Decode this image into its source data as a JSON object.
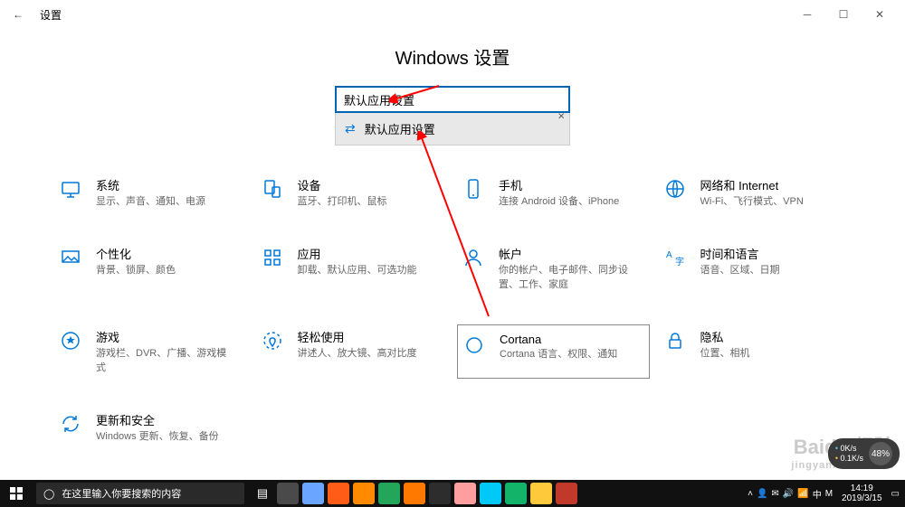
{
  "titlebar": {
    "back": "←",
    "title": "设置"
  },
  "header": {
    "title": "Windows 设置"
  },
  "search": {
    "value": "默认应用设置",
    "clear": "×",
    "suggestion_label": "默认应用设置",
    "suggestion_icon": "⇄"
  },
  "tiles": [
    {
      "key": "system",
      "title": "系统",
      "desc": "显示、声音、通知、电源"
    },
    {
      "key": "devices",
      "title": "设备",
      "desc": "蓝牙、打印机、鼠标"
    },
    {
      "key": "phone",
      "title": "手机",
      "desc": "连接 Android 设备、iPhone"
    },
    {
      "key": "network",
      "title": "网络和 Internet",
      "desc": "Wi-Fi、飞行模式、VPN"
    },
    {
      "key": "personalization",
      "title": "个性化",
      "desc": "背景、锁屏、颜色"
    },
    {
      "key": "apps",
      "title": "应用",
      "desc": "卸载、默认应用、可选功能"
    },
    {
      "key": "accounts",
      "title": "帐户",
      "desc": "你的帐户、电子邮件、同步设置、工作、家庭"
    },
    {
      "key": "time",
      "title": "时间和语言",
      "desc": "语音、区域、日期"
    },
    {
      "key": "gaming",
      "title": "游戏",
      "desc": "游戏栏、DVR、广播、游戏模式"
    },
    {
      "key": "ease",
      "title": "轻松使用",
      "desc": "讲述人、放大镜、高对比度"
    },
    {
      "key": "cortana",
      "title": "Cortana",
      "desc": "Cortana 语言、权限、通知",
      "highlight": true
    },
    {
      "key": "privacy",
      "title": "隐私",
      "desc": "位置、相机"
    },
    {
      "key": "update",
      "title": "更新和安全",
      "desc": "Windows 更新、恢复、备份"
    }
  ],
  "taskbar": {
    "search_placeholder": "在这里输入你要搜索的内容",
    "clock_time": "14:19",
    "clock_date": "2019/3/15"
  },
  "netbadge": {
    "up": "0K/s",
    "down": "0.1K/s",
    "percent": "48%"
  },
  "watermark": {
    "brand": "Baidu 经验",
    "sub": "jingyan.baidu.com"
  },
  "apps": {
    "colors": [
      "#4a4a4a",
      "#6aa5ff",
      "#ff5c17",
      "#ff8a00",
      "#23a55a",
      "#ff7900",
      "#2d2d2d",
      "#ff9e9e",
      "#00c9f7",
      "#14b36a",
      "#ffc93c",
      "#c0392b"
    ]
  }
}
